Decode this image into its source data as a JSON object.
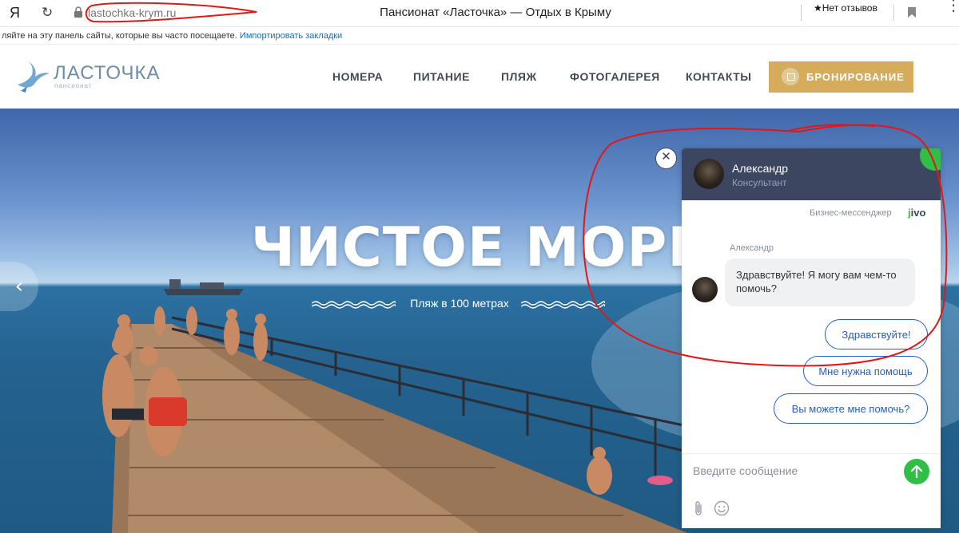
{
  "browser": {
    "logo_glyph": "Я",
    "reload_glyph": "↻",
    "url": "lastochka-krym.ru",
    "tab_title": "Пансионат «Ласточка» — Отдых в Крыму",
    "reviews_label": "★Нет отзывов",
    "more_glyph": "⋮",
    "bookmarks_hint": "ляйте на эту панель сайты, которые вы часто посещаете.",
    "bookmarks_import": "Импортировать закладки"
  },
  "site": {
    "logo_name": "ЛАСТОЧКА",
    "logo_sub": "пансионат",
    "nav": [
      "НОМЕРА",
      "ПИТАНИЕ",
      "ПЛЯЖ",
      "ФОТОГАЛЕРЕЯ",
      "КОНТАКТЫ"
    ],
    "book_label": "БРОНИРОВАНИЕ",
    "accent": "#d4ac5b"
  },
  "hero": {
    "title": "ЧИСТОЕ МОРЕ",
    "subtitle": "Пляж в 100 метрах",
    "prev_glyph": "‹"
  },
  "chat": {
    "close_glyph": "✕",
    "agent_name": "Александр",
    "agent_role": "Консультант",
    "powered_by": "Бизнес-мессенджер",
    "brand_j": "j",
    "brand_rest": "ivo",
    "message_author": "Александр",
    "message_text": "Здравствуйте! Я могу вам чем-то помочь?",
    "quick_replies": [
      "Здравствуйте!",
      "Мне нужна помощь",
      "Вы можете мне помочь?"
    ],
    "input_placeholder": "Введите сообщение",
    "header_color": "#3d4660",
    "online_color": "#2fbf47",
    "reply_color": "#2560c2"
  }
}
